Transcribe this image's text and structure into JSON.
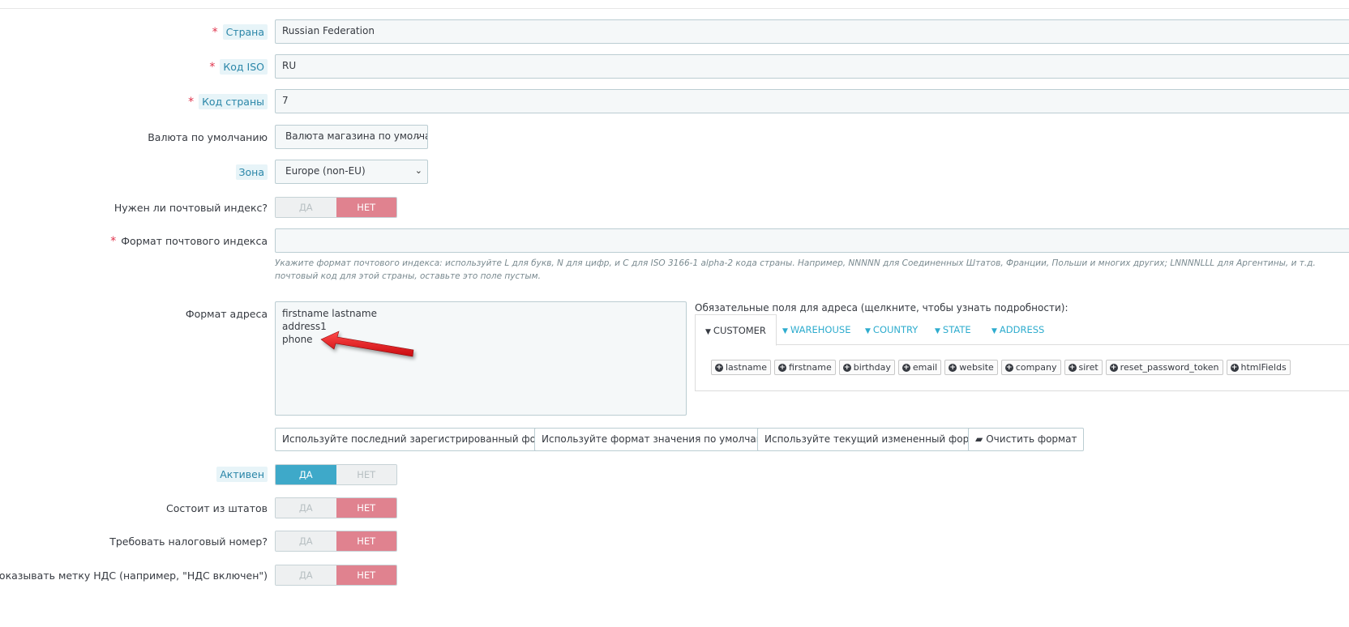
{
  "form": {
    "country": {
      "label": "Страна",
      "value": "Russian Federation"
    },
    "iso": {
      "label": "Код ISO",
      "value": "RU"
    },
    "call_prefix": {
      "label": "Код страны",
      "value": "7"
    },
    "currency": {
      "label": "Валюта по умолчанию",
      "value": "Валюта магазина по умолча"
    },
    "zone": {
      "label": "Зона",
      "value": "Europe (non-EU)"
    },
    "zip_required": {
      "label": "Нужен ли почтовый индекс?",
      "yes": "ДА",
      "no": "НЕТ",
      "selected": "no"
    },
    "zip_format": {
      "label": "Формат почтового индекса",
      "value": "",
      "help_line1": "Укажите формат почтового индекса: используйте L для букв, N для цифр, и C для ISO 3166-1 alpha-2 кода страны. Например, NNNNN для Соединенных Штатов, Франции, Польши и многих других; LNNNNLLL для Аргентины, и т.д.",
      "help_line2": "почтовый код для этой страны, оставьте это поле пустым."
    },
    "address_format": {
      "label": "Формат адреса",
      "lines": [
        "firstname lastname",
        "address1",
        "phone"
      ]
    },
    "required_fields": {
      "title": "Обязательные поля для адреса (щелкните, чтобы узнать подробности):",
      "tabs": [
        "CUSTOMER",
        "WAREHOUSE",
        "COUNTRY",
        "STATE",
        "ADDRESS"
      ],
      "active_tab": "CUSTOMER",
      "chips": [
        "lastname",
        "firstname",
        "birthday",
        "email",
        "website",
        "company",
        "siret",
        "reset_password_token",
        "htmlFields"
      ]
    },
    "buttons": {
      "last_format": "Используйте последний зарегистрированный формат",
      "default_format": "Используйте формат значения по умолчанию",
      "current_format": "Используйте текущий измененный формат",
      "clear_format": "Очистить формат"
    },
    "active": {
      "label": "Активен",
      "yes": "ДА",
      "no": "НЕТ",
      "selected": "yes"
    },
    "contains_states": {
      "label": "Состоит из штатов",
      "yes": "ДА",
      "no": "НЕТ",
      "selected": "no"
    },
    "need_tax_id": {
      "label": "Требовать налоговый номер?",
      "yes": "ДА",
      "no": "НЕТ",
      "selected": "no"
    },
    "display_tax_label": {
      "label": "Показывать метку НДС (например, \"НДС включен\")",
      "yes": "ДА",
      "no": "НЕТ",
      "selected": "no"
    }
  },
  "colors": {
    "required_star": "#e0334c",
    "switch_no": "#e0828f",
    "switch_yes": "#3ea9c9",
    "tab_link": "#2eacce",
    "arrow": "#e8161c"
  }
}
